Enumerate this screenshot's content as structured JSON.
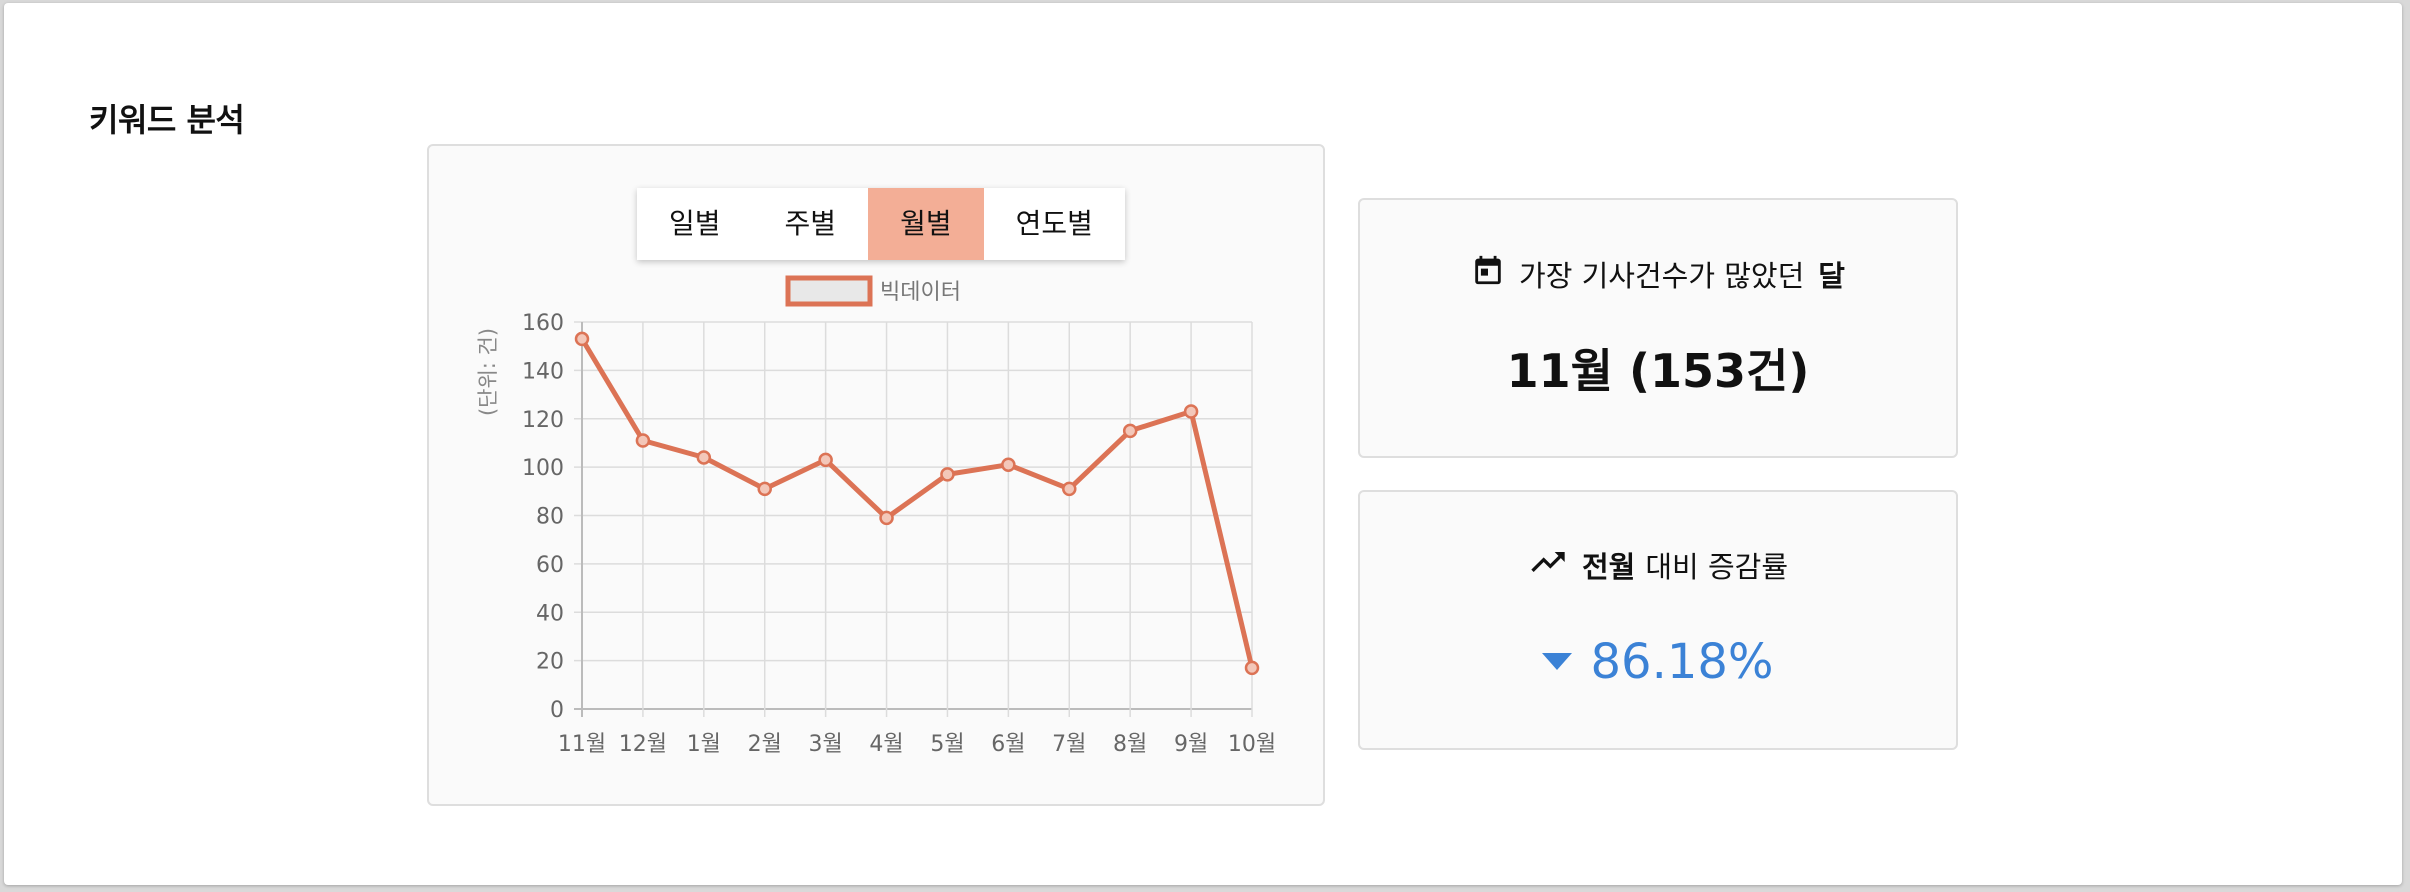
{
  "section_title": "키워드 분석",
  "tabs": [
    {
      "label": "일별",
      "active": false
    },
    {
      "label": "주별",
      "active": false
    },
    {
      "label": "월별",
      "active": true
    },
    {
      "label": "연도별",
      "active": false
    }
  ],
  "chart_data": {
    "type": "line",
    "categories": [
      "11월",
      "12월",
      "1월",
      "2월",
      "3월",
      "4월",
      "5월",
      "6월",
      "7월",
      "8월",
      "9월",
      "10월"
    ],
    "series": [
      {
        "name": "빅데이터",
        "values": [
          153,
          111,
          104,
          91,
          103,
          79,
          97,
          101,
          91,
          115,
          123,
          17
        ]
      }
    ],
    "ylabel": "(단위: 건)",
    "ylim": [
      0,
      160
    ],
    "yticks": [
      0,
      20,
      40,
      60,
      80,
      100,
      120,
      140,
      160
    ],
    "grid": true,
    "legend_position": "top",
    "colors": {
      "line": "#dc7355",
      "legend_fill": "#e8e8e8"
    }
  },
  "max_month_card": {
    "icon": "calendar-icon",
    "label": "가장 기사건수가 많았던",
    "label_bold": "달",
    "value": "11월 (153건)"
  },
  "change_card": {
    "icon": "trending-up-icon",
    "label_bold": "전월",
    "label": "대비 증감률",
    "direction": "down",
    "value": "86.18%",
    "color": "#3b82d6"
  }
}
